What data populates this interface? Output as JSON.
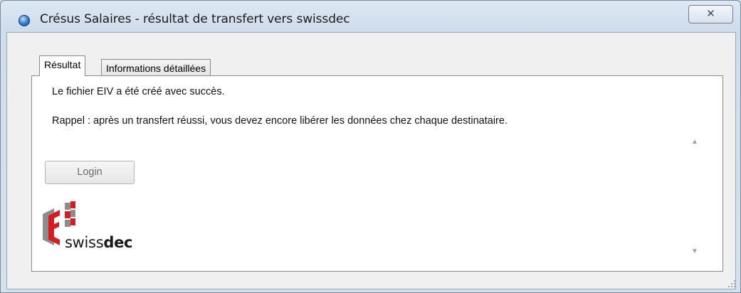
{
  "window": {
    "title": "Crésus Salaires - résultat de transfert vers swissdec",
    "close_glyph": "✕"
  },
  "tabs": [
    {
      "label": "Résultat",
      "active": true
    },
    {
      "label": "Informations détaillées",
      "active": false
    }
  ],
  "content": {
    "line1": "Le fichier EIV a été créé avec succès.",
    "line2": "Rappel : après un transfert réussi, vous devez encore libérer les données chez chaque destinataire."
  },
  "buttons": {
    "login": "Login"
  },
  "logo": {
    "text_regular": "swiss",
    "text_bold": "dec"
  },
  "scroll": {
    "up": "▲",
    "down": "▼"
  },
  "colors": {
    "logo_red": "#d21f26",
    "logo_grey": "#8c8c8c"
  }
}
